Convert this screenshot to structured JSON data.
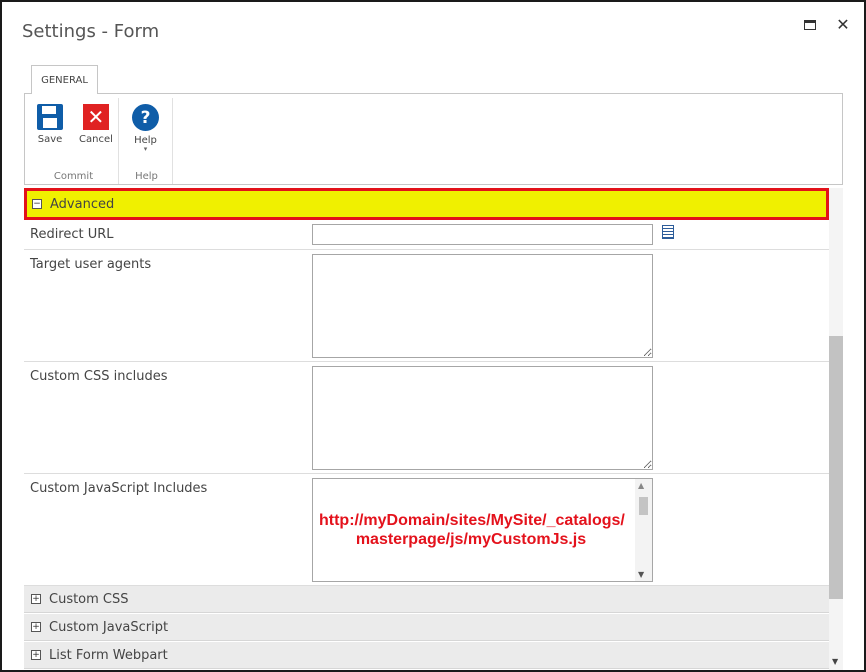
{
  "dialog": {
    "title": "Settings - Form",
    "maximize_icon": "maximize-icon",
    "close_symbol": "✕"
  },
  "ribbon": {
    "tab_label": "GENERAL",
    "groups": {
      "commit": {
        "label": "Commit",
        "save_label": "Save",
        "cancel_label": "Cancel",
        "cancel_symbol": "✕"
      },
      "help": {
        "label": "Help",
        "help_label": "Help",
        "help_symbol": "?",
        "caret_symbol": "▾"
      }
    }
  },
  "advanced": {
    "expander_symbol": "−",
    "label": "Advanced",
    "highlight_color": "#f0f000",
    "highlight_border": "#e2121a"
  },
  "fields": {
    "redirect_url": {
      "label": "Redirect URL",
      "value": ""
    },
    "target_user_agents": {
      "label": "Target user agents",
      "value": ""
    },
    "custom_css_includes": {
      "label": "Custom CSS includes",
      "value": ""
    },
    "custom_js_includes": {
      "label": "Custom JavaScript Includes",
      "overlay_text": "http://myDomain/sites/MySite/_catalogs/ masterpage/js/myCustomJs.js",
      "overlay_color": "#e4121c"
    }
  },
  "sections": [
    {
      "label": "Custom CSS",
      "expander_symbol": "+"
    },
    {
      "label": "Custom JavaScript",
      "expander_symbol": "+"
    },
    {
      "label": "List Form Webpart",
      "expander_symbol": "+"
    }
  ],
  "scroll": {
    "up_symbol": "▲",
    "down_symbol": "▼"
  }
}
